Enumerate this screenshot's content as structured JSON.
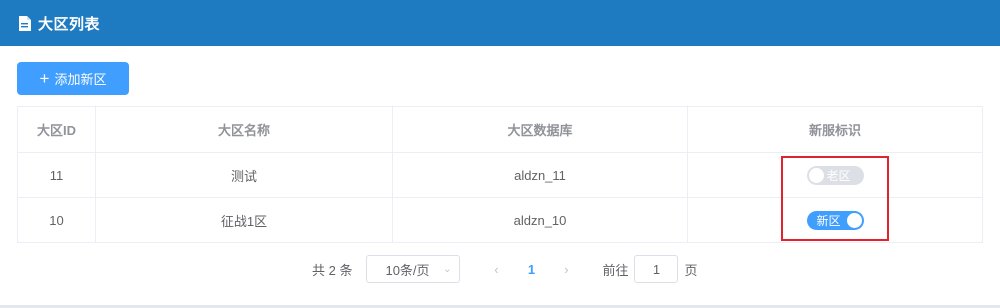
{
  "header": {
    "title": "大区列表",
    "icon": "document-icon"
  },
  "toolbar": {
    "add_label": "添加新区",
    "add_icon": "plus-icon"
  },
  "table": {
    "columns": [
      "大区ID",
      "大区名称",
      "大区数据库",
      "新服标识"
    ],
    "rows": [
      {
        "id": "11",
        "name": "测试",
        "db": "aldzn_11",
        "flag": "老区",
        "flag_on": false
      },
      {
        "id": "10",
        "name": "征战1区",
        "db": "aldzn_10",
        "flag": "新区",
        "flag_on": true
      }
    ]
  },
  "pagination": {
    "total_text": "共 2 条",
    "page_size": "10条/页",
    "current_page": "1",
    "goto_label": "前往",
    "goto_value": "1",
    "page_suffix": "页"
  },
  "colors": {
    "header_bg": "#1f7bc1",
    "primary": "#409eff",
    "highlight": "#e0242d"
  }
}
